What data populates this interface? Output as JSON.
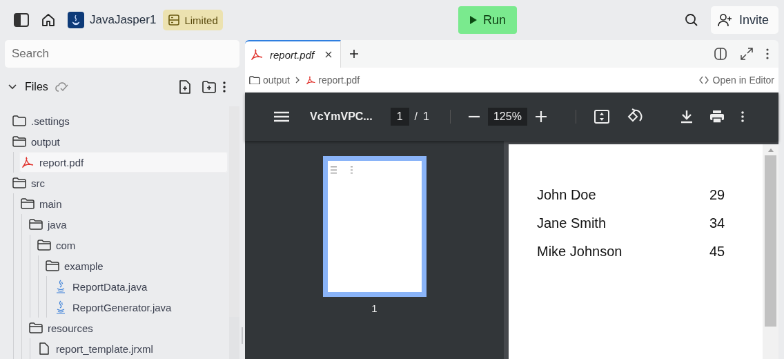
{
  "topbar": {
    "project": "JavaJasper1",
    "badge": "Limited",
    "run_button": "Run",
    "invite_button": "Invite"
  },
  "sidebar": {
    "search": {
      "placeholder": "Search"
    },
    "section": {
      "title": "Files",
      "expanded": true
    },
    "tree": [
      {
        "kind": "folder",
        "label": ".settings",
        "expanded": false,
        "selected": false
      },
      {
        "kind": "folder",
        "label": "output",
        "expanded": true,
        "selected": false,
        "children": [
          {
            "kind": "pdf",
            "label": "report.pdf",
            "selected": true
          }
        ]
      },
      {
        "kind": "folder",
        "label": "src",
        "expanded": true,
        "selected": false,
        "children": [
          {
            "kind": "folder",
            "label": "main",
            "expanded": true,
            "selected": false,
            "children": [
              {
                "kind": "folder",
                "label": "java",
                "expanded": true,
                "selected": false,
                "children": [
                  {
                    "kind": "folder",
                    "label": "com",
                    "expanded": true,
                    "selected": false,
                    "children": [
                      {
                        "kind": "folder",
                        "label": "example",
                        "expanded": true,
                        "selected": false,
                        "children": [
                          {
                            "kind": "java",
                            "label": "ReportData.java",
                            "selected": false
                          },
                          {
                            "kind": "java",
                            "label": "ReportGenerator.java",
                            "selected": false
                          }
                        ]
                      }
                    ]
                  }
                ]
              },
              {
                "kind": "folder",
                "label": "resources",
                "expanded": true,
                "selected": false,
                "children": [
                  {
                    "kind": "file",
                    "label": "report_template.jrxml",
                    "selected": false
                  }
                ]
              }
            ]
          }
        ]
      }
    ]
  },
  "editor": {
    "tabs": [
      {
        "label": "report.pdf",
        "kind": "pdf",
        "selected": true
      }
    ],
    "breadcrumb": [
      {
        "kind": "folder",
        "label": "output"
      },
      {
        "kind": "pdf",
        "label": "report.pdf"
      }
    ],
    "open_in_editor": "Open in Editor",
    "pdf_viewer": {
      "title": "VcYmVPC...",
      "page": "1",
      "page_separator": "/",
      "page_count": "1",
      "zoom": "125%",
      "thumbnails": [
        {
          "label": "1",
          "selected": true
        }
      ],
      "rows": [
        {
          "name": "John Doe",
          "age": "29"
        },
        {
          "name": "Jane Smith",
          "age": "34"
        },
        {
          "name": "Mike Johnson",
          "age": "45"
        }
      ]
    }
  }
}
